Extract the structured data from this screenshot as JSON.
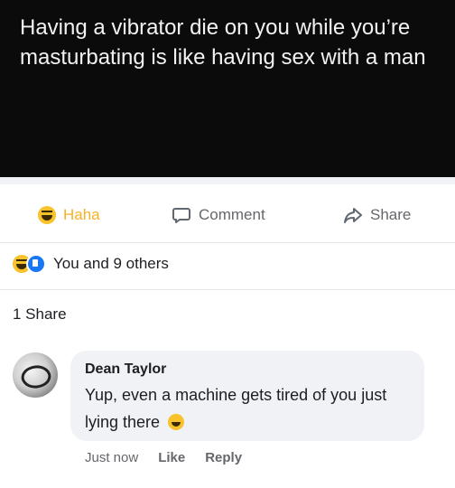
{
  "post": {
    "text": "Having a vibrator die on you while you’re masturbating is like having sex with a man"
  },
  "actions": {
    "haha_label": "Haha",
    "comment_label": "Comment",
    "share_label": "Share"
  },
  "reactions": {
    "summary": "You and 9 others"
  },
  "shares": {
    "count_label": "1 Share"
  },
  "comment": {
    "author": "Dean Taylor",
    "text": "Yup, even a machine gets tired of you just lying there",
    "timestamp": "Just now",
    "like_label": "Like",
    "reply_label": "Reply"
  },
  "colors": {
    "haha_accent": "#f7b125",
    "like_blue": "#1877f2"
  }
}
